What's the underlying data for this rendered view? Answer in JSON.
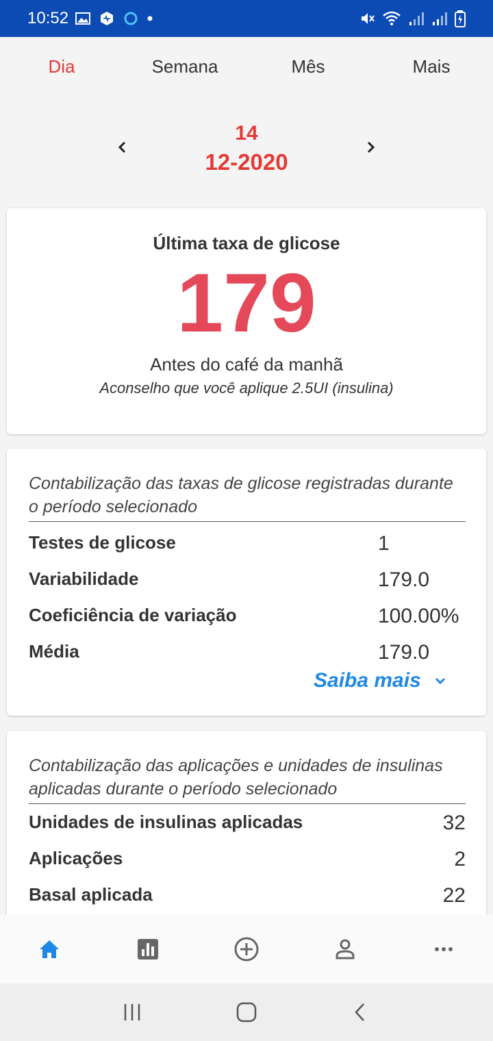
{
  "status": {
    "time": "10:52"
  },
  "tabs": [
    {
      "label": "Dia",
      "active": true
    },
    {
      "label": "Semana",
      "active": false
    },
    {
      "label": "Mês",
      "active": false
    },
    {
      "label": "Mais",
      "active": false
    }
  ],
  "date": {
    "day": "14",
    "month_year": "12-2020"
  },
  "last_glucose": {
    "title": "Última taxa de glicose",
    "value": "179",
    "meal": "Antes do café da manhã",
    "advice": "Aconselho que você aplique 2.5UI (insulina)"
  },
  "glucose_stats": {
    "description": "Contabilização das taxas de glicose registradas durante o período selecionado",
    "rows": [
      {
        "label": "Testes de glicose",
        "value": "1"
      },
      {
        "label": "Variabilidade",
        "value": "179.0"
      },
      {
        "label": "Coeficiência de variação",
        "value": "100.00%"
      },
      {
        "label": "Média",
        "value": "179.0"
      }
    ],
    "more_label": "Saiba mais"
  },
  "insulin_stats": {
    "description": "Contabilização das aplicações e unidades de insulinas aplicadas durante o período selecionado",
    "rows": [
      {
        "label": "Unidades de insulinas aplicadas",
        "value": "32"
      },
      {
        "label": "Aplicações",
        "value": "2"
      },
      {
        "label": "Basal aplicada",
        "value": "22"
      }
    ]
  },
  "bottom_nav": [
    {
      "icon": "home-icon",
      "active": true
    },
    {
      "icon": "bar-chart-icon",
      "active": false
    },
    {
      "icon": "add-circle-icon",
      "active": false
    },
    {
      "icon": "person-icon",
      "active": false
    },
    {
      "icon": "more-icon",
      "active": false
    }
  ],
  "colors": {
    "accent": "#e53935",
    "value_red": "#e54859",
    "link_blue": "#1e88e5",
    "status_bar": "#0b4bb3"
  }
}
